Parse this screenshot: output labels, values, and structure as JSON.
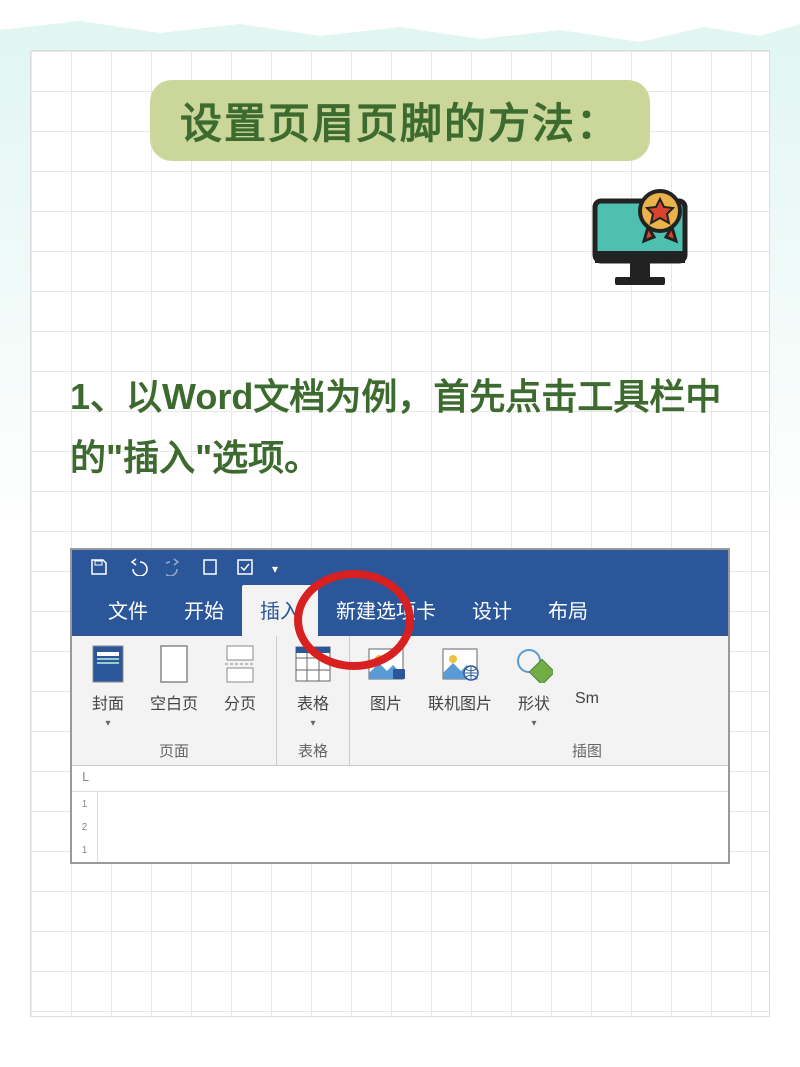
{
  "title": "设置页眉页脚的方法：",
  "decor_icon": "monitor-award-icon",
  "step_text": "1、以Word文档为例，首先点击工具栏中的\"插入\"选项。",
  "word": {
    "qat": {
      "save": "save-icon",
      "undo": "undo-icon",
      "redo": "redo-icon",
      "doc": "doc-icon",
      "check": "check-icon"
    },
    "tabs": [
      "文件",
      "开始",
      "插入",
      "新建选项卡",
      "设计",
      "布局"
    ],
    "active_tab": "插入",
    "ribbon": {
      "groups": [
        {
          "label": "页面",
          "items": [
            {
              "label": "封面",
              "dropdown": true,
              "icon": "cover-page-icon"
            },
            {
              "label": "空白页",
              "dropdown": false,
              "icon": "blank-page-icon"
            },
            {
              "label": "分页",
              "dropdown": false,
              "icon": "page-break-icon"
            }
          ]
        },
        {
          "label": "表格",
          "items": [
            {
              "label": "表格",
              "dropdown": true,
              "icon": "table-icon"
            }
          ]
        },
        {
          "label": "插图",
          "items": [
            {
              "label": "图片",
              "dropdown": false,
              "icon": "picture-icon"
            },
            {
              "label": "联机图片",
              "dropdown": false,
              "icon": "online-picture-icon"
            },
            {
              "label": "形状",
              "dropdown": true,
              "icon": "shapes-icon"
            },
            {
              "label": "Sm",
              "dropdown": false,
              "icon": "smartart-icon"
            }
          ]
        }
      ]
    },
    "vruler_marks": [
      "1",
      "2",
      "1"
    ],
    "circled_tab": "插入"
  }
}
